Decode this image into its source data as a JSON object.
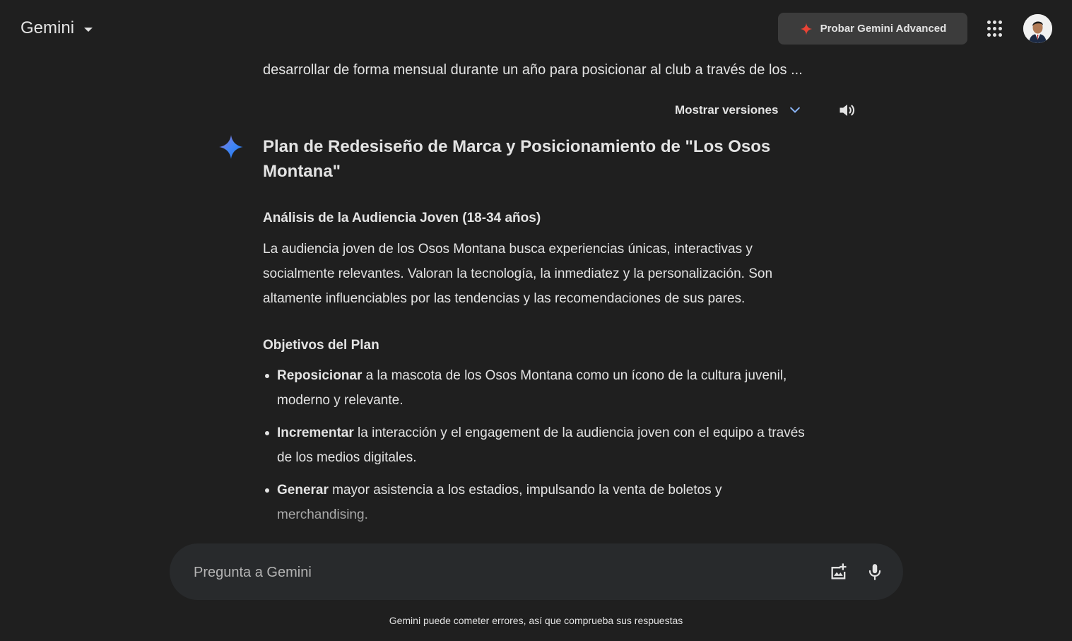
{
  "header": {
    "brand": "Gemini",
    "advanced_button": "Probar Gemini Advanced",
    "icons": [
      "chevron-down-icon",
      "sparkle-icon",
      "apps-grid-icon",
      "avatar"
    ]
  },
  "conversation": {
    "user_prompt_tail": "desarrollar de forma mensual durante un año para posicionar al club a través de los ...",
    "show_versions": "Mostrar versiones",
    "response": {
      "title": "Plan de Redesiseño de Marca y Posicionamiento de \"Los Osos Montana\"",
      "section1_heading": "Análisis de la Audiencia Joven (18-34 años)",
      "section1_paragraph": "La audiencia joven de los Osos Montana busca experiencias únicas, interactivas y socialmente relevantes. Valoran la tecnología, la inmediatez y la personalización. Son altamente influenciables por las tendencias y las recomendaciones de sus pares.",
      "section2_heading": "Objetivos del Plan",
      "objectives": [
        {
          "bold": "Reposicionar",
          "text": " a la mascota de los Osos Montana como un ícono de la cultura juvenil, moderno y relevante."
        },
        {
          "bold": "Incrementar",
          "text": " la interacción y el engagement de la audiencia joven con el equipo a través de los medios digitales."
        },
        {
          "bold": "Generar",
          "text": " mayor asistencia a los estadios, impulsando la venta de boletos y merchandising."
        }
      ]
    }
  },
  "input": {
    "placeholder": "Pregunta a Gemini"
  },
  "footer": {
    "disclaimer": "Gemini puede cometer errores, así que comprueba sus respuestas"
  },
  "colors": {
    "background": "#1f1f1f",
    "input_bg": "#282a2c",
    "button_bg": "#3c3c3c",
    "accent_blue": "#8ab4f8",
    "sparkle_red": "#ea4335"
  }
}
